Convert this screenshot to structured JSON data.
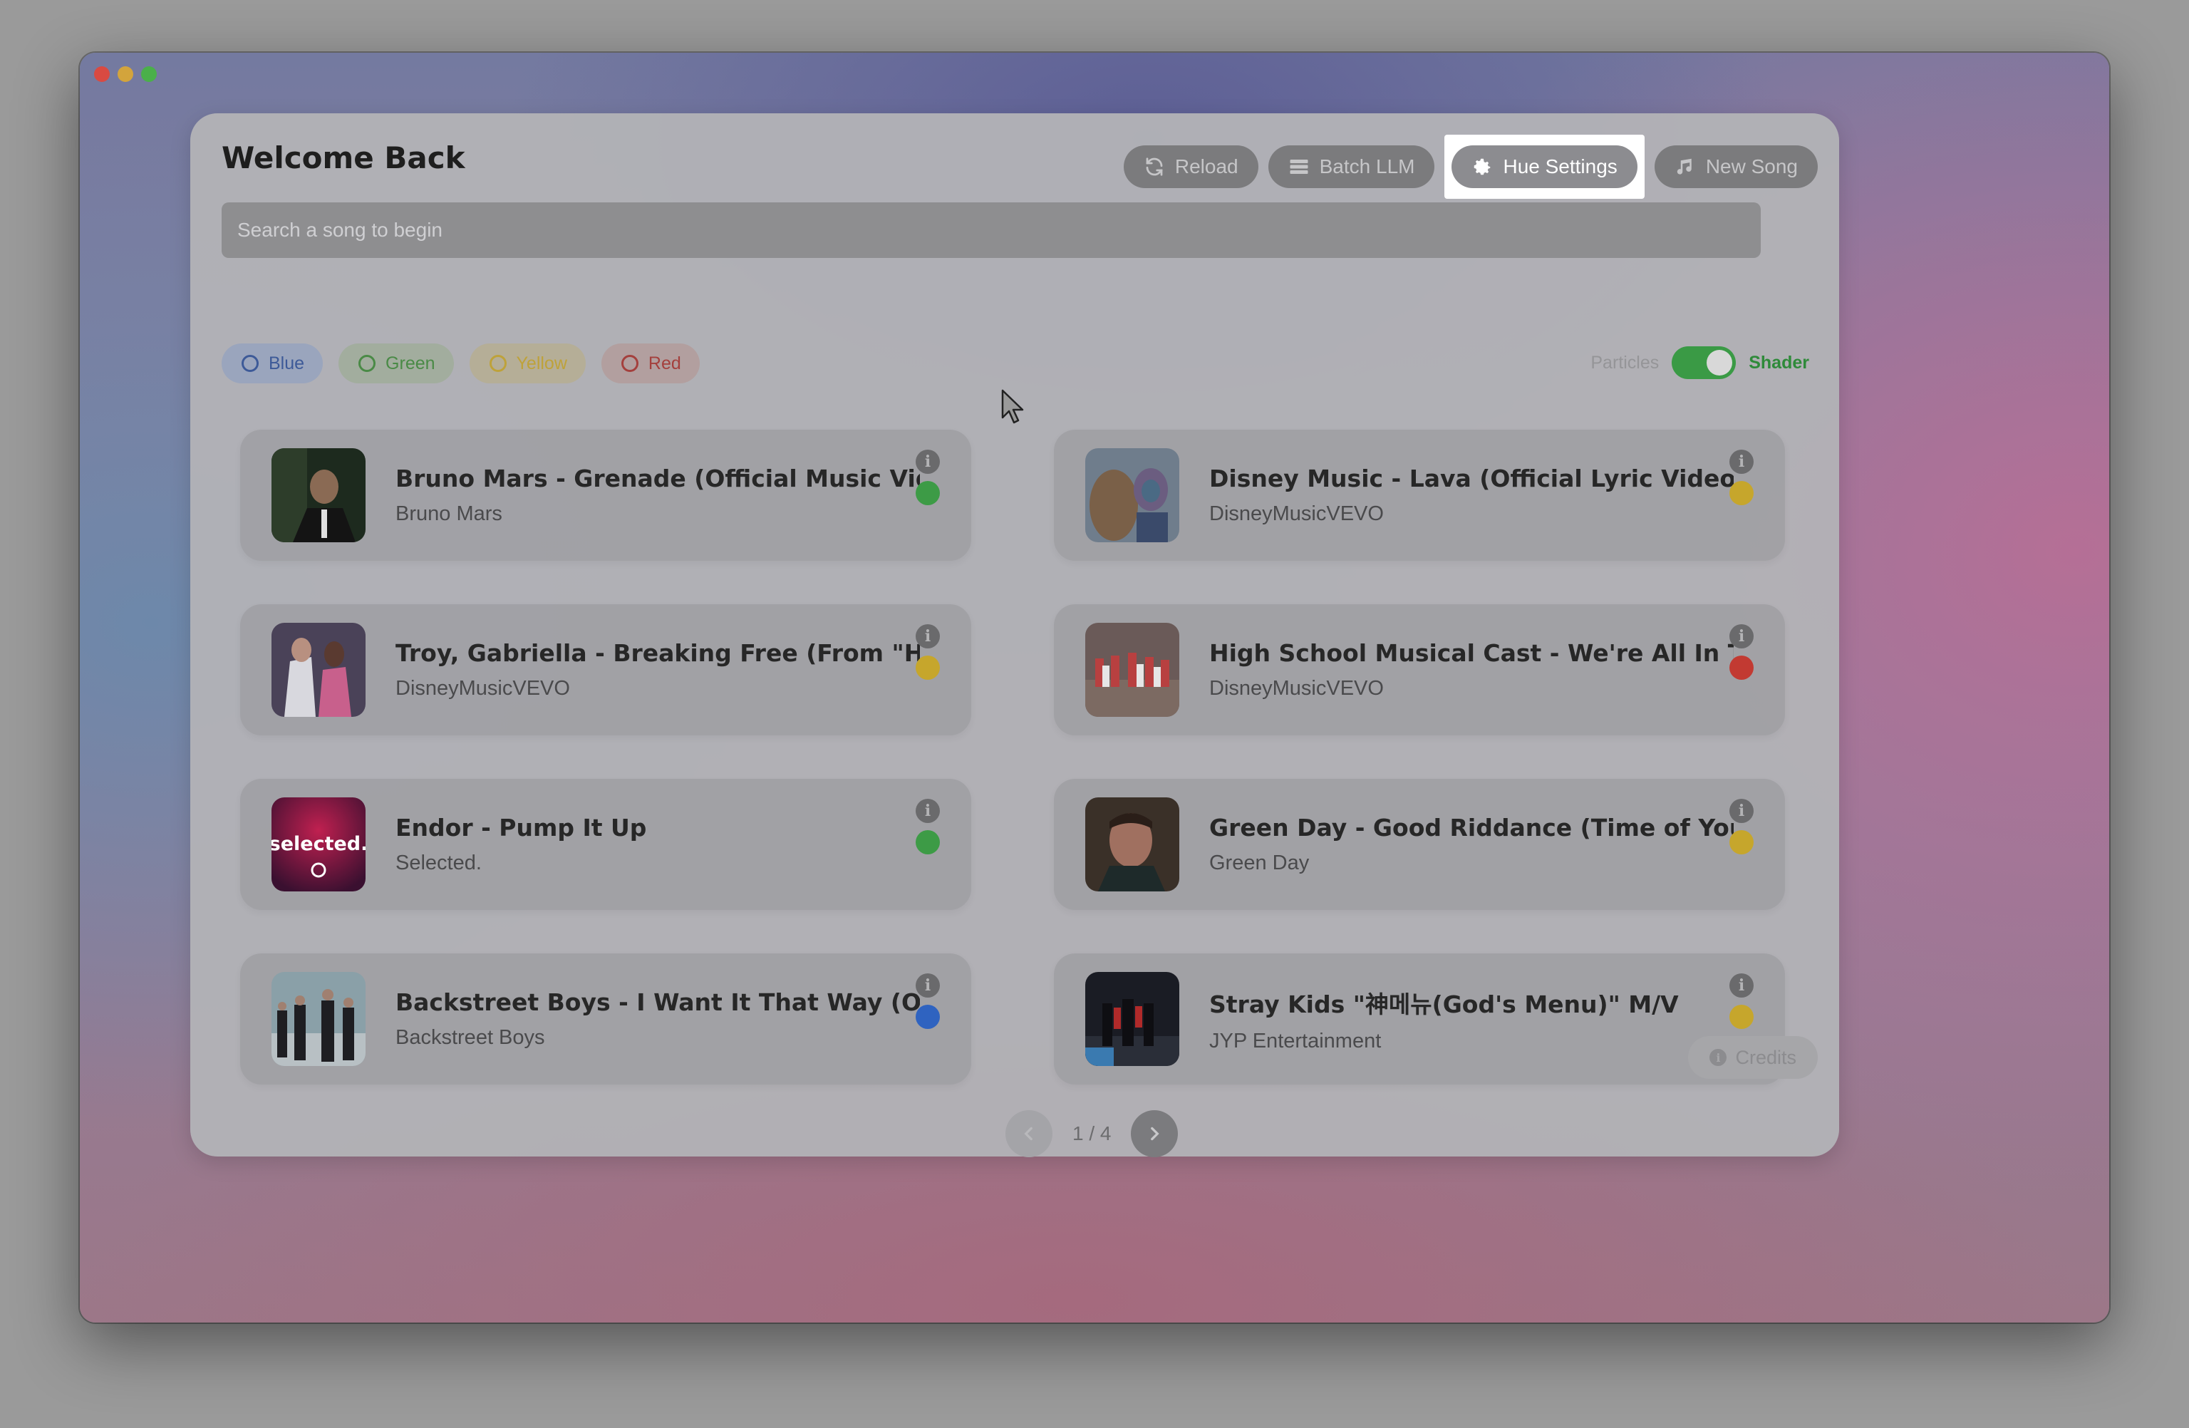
{
  "header": {
    "title": "Welcome Back",
    "buttons": [
      {
        "label": "Reload",
        "icon": "refresh-icon"
      },
      {
        "label": "Batch LLM",
        "icon": "stack-icon"
      },
      {
        "label": "Hue Settings",
        "icon": "gear-icon",
        "highlighted": true
      },
      {
        "label": "New Song",
        "icon": "music-note-icon"
      }
    ]
  },
  "search": {
    "placeholder": "Search a song to begin"
  },
  "filters": [
    {
      "label": "Blue",
      "color": "#3d5a98"
    },
    {
      "label": "Green",
      "color": "#4a8a46"
    },
    {
      "label": "Yellow",
      "color": "#bea23a"
    },
    {
      "label": "Red",
      "color": "#a4403d"
    }
  ],
  "mode_toggle": {
    "left_label": "Particles",
    "right_label": "Shader",
    "on": true
  },
  "songs": [
    {
      "title": "Bruno Mars - Grenade (Official Music Video)",
      "artist": "Bruno Mars",
      "hue": "green"
    },
    {
      "title": "Disney Music - Lava (Official Lyric Video from Lava)",
      "artist": "DisneyMusicVEVO",
      "hue": "yellow"
    },
    {
      "title": "Troy, Gabriella - Breaking Free (From \"High School Musical\")",
      "artist": "DisneyMusicVEVO",
      "hue": "yellow"
    },
    {
      "title": "High School Musical Cast - We're All In This Together",
      "artist": "DisneyMusicVEVO",
      "hue": "red"
    },
    {
      "title": "Endor - Pump It Up",
      "artist": "Selected.",
      "hue": "green"
    },
    {
      "title": "Green Day - Good Riddance (Time of Your Life)",
      "artist": "Green Day",
      "hue": "yellow"
    },
    {
      "title": "Backstreet Boys - I Want It That Way (Official Music Video)",
      "artist": "Backstreet Boys",
      "hue": "blue"
    },
    {
      "title": "Stray Kids \"神메뉴(God's Menu)\" M/V",
      "artist": "JYP Entertainment",
      "hue": "yellow"
    }
  ],
  "thumb_text": {
    "selected": "selected."
  },
  "pagination": {
    "label": "1 / 4",
    "current": 1,
    "total": 4
  },
  "footer": {
    "credits_label": "Credits"
  },
  "colors": {
    "green": "#3d9b46",
    "yellow": "#c6a62c",
    "red": "#c23a32",
    "blue": "#2f63c0",
    "toggle_on": "#3a9a45"
  }
}
